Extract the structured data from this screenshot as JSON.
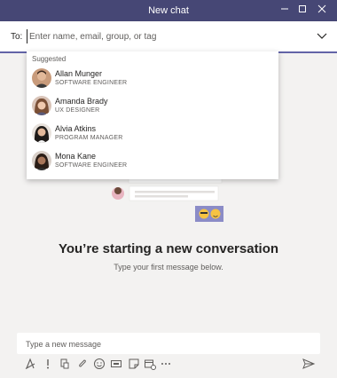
{
  "window": {
    "title": "New chat"
  },
  "to_field": {
    "label": "To:",
    "placeholder": "Enter name, email, group, or tag"
  },
  "suggestions": {
    "label": "Suggested",
    "people": [
      {
        "name": "Allan Munger",
        "role": "SOFTWARE ENGINEER"
      },
      {
        "name": "Amanda Brady",
        "role": "UX DESIGNER"
      },
      {
        "name": "Alvia Atkins",
        "role": "PROGRAM MANAGER"
      },
      {
        "name": "Mona Kane",
        "role": "SOFTWARE ENGINEER"
      }
    ]
  },
  "empty_state": {
    "title": "You’re starting a new conversation",
    "subtitle": "Type your first message below."
  },
  "composer": {
    "placeholder": "Type a new message"
  },
  "toolbar_icons": [
    "format-icon",
    "urgent-icon",
    "attach-icon",
    "link-icon",
    "emoji-icon",
    "gif-icon",
    "sticker-icon",
    "meet-icon",
    "more-icon",
    "send-icon"
  ],
  "colors": {
    "titlebar": "#464775",
    "accent": "#6264a7",
    "background": "#f3f2f1"
  }
}
